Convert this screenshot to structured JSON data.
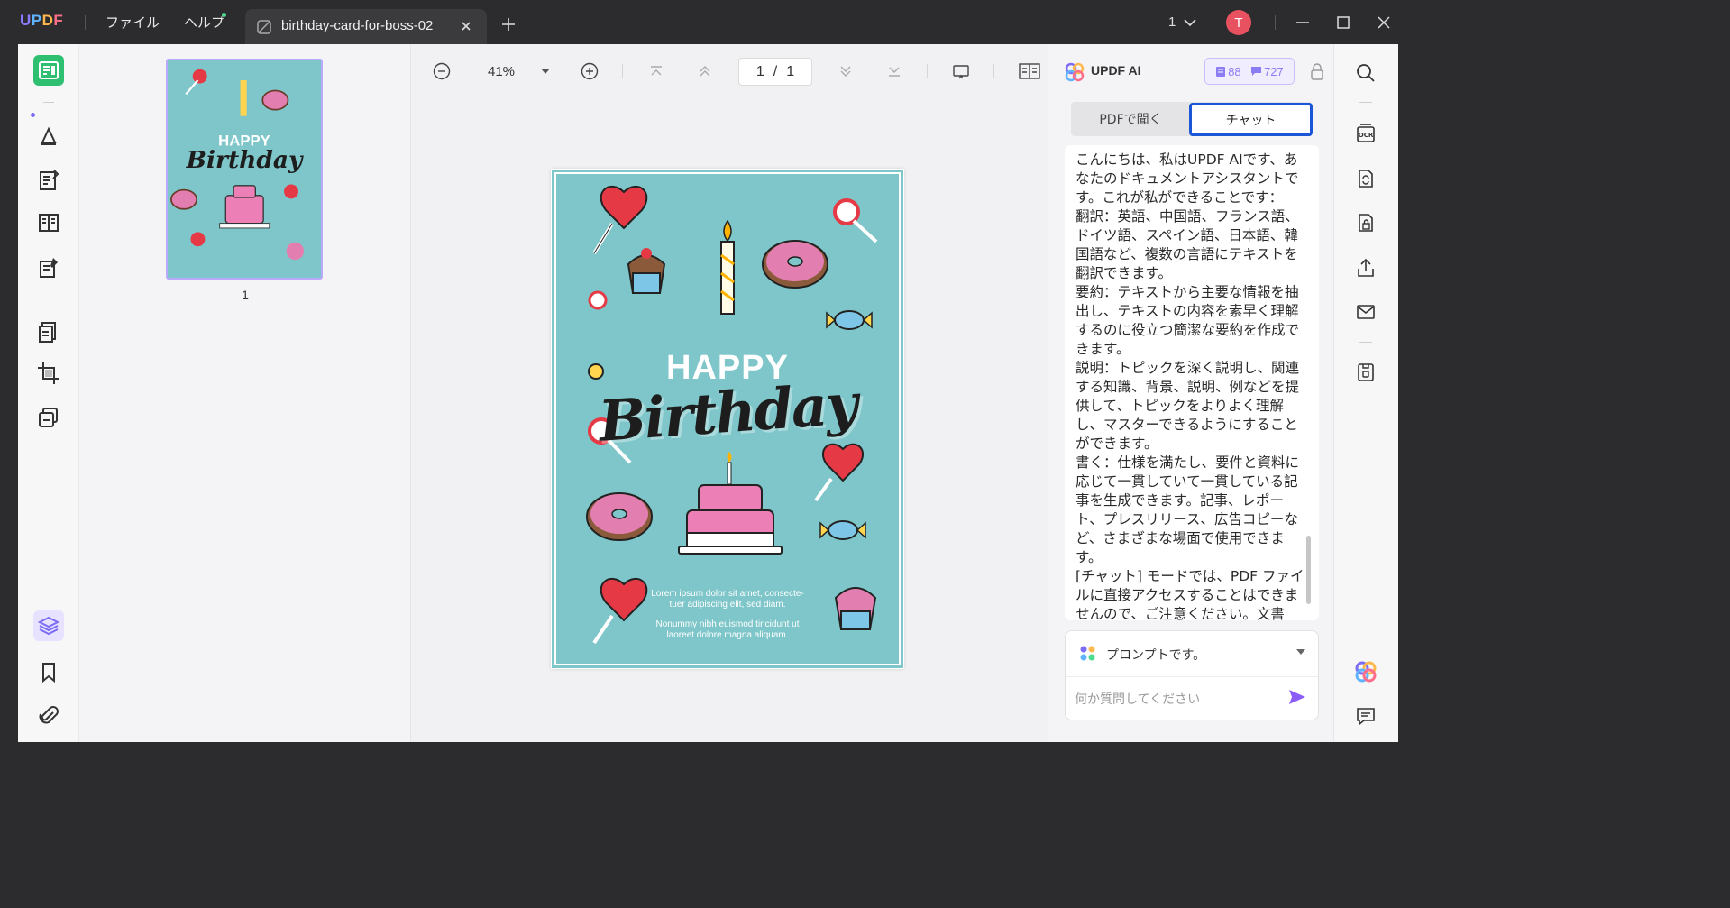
{
  "app": {
    "brand": "UPDF",
    "menu": {
      "file": "ファイル",
      "help": "ヘルプ"
    },
    "tab": {
      "title": "birthday-card-for-boss-02"
    },
    "window_count": "1",
    "avatar_initial": "T",
    "colors": {
      "accent": "#7b6cf6",
      "active_tool": "#2fbf71",
      "avatar": "#e8515f",
      "chat_tab_border": "#1a56d6"
    }
  },
  "thumbnails": {
    "items": [
      {
        "number": "1"
      }
    ]
  },
  "toolbar": {
    "zoom": "41%",
    "page_current": "1",
    "page_separator": "/",
    "page_total": "1"
  },
  "document": {
    "happy": "HAPPY",
    "birthday": "Birthday",
    "lorem1_line1": "Lorem ipsum dolor sit amet, consecte-",
    "lorem1_line2": "tuer adipiscing elit, sed diam.",
    "lorem2_line1": "Nonummy nibh euismod tincidunt ut",
    "lorem2_line2": "laoreet dolore magna aliquam.",
    "colors": {
      "card_bg": "#7ec6c9",
      "donut": "#e37fb0",
      "heart": "#e53946",
      "cake_pink": "#ec7fb5"
    }
  },
  "ai": {
    "title": "UPDF AI",
    "credits_docs": "88",
    "credits_chat": "727",
    "tabs": {
      "ask_pdf": "PDFで聞く",
      "chat": "チャット"
    },
    "message": [
      "こんにちは、私はUPDF AIです、あなたのドキュメントアシスタントです。これが私ができることです：",
      "翻訳：英語、中国語、フランス語、ドイツ語、スペイン語、日本語、韓国語など、複数の言語にテキストを翻訳できます。",
      "要約：テキストから主要な情報を抽出し、テキストの内容を素早く理解するのに役立つ簡潔な要約を作成できます。",
      "説明：トピックを深く説明し、関連する知識、背景、説明、例などを提供して、トピックをよりよく理解し、マスターできるようにすることができます。",
      "書く：仕様を満たし、要件と資料に応じて一貫していて一貫している記事を生成できます。記事、レポート、プレスリリース、広告コピーなど、さまざまな場面で使用できます。",
      "[チャット] モードでは、PDF ファイルに直接アクセスすることはできませんので、ご注意ください。文書"
    ],
    "prompt_label": "プロンプトです。",
    "input_placeholder": "何か質問してください"
  }
}
